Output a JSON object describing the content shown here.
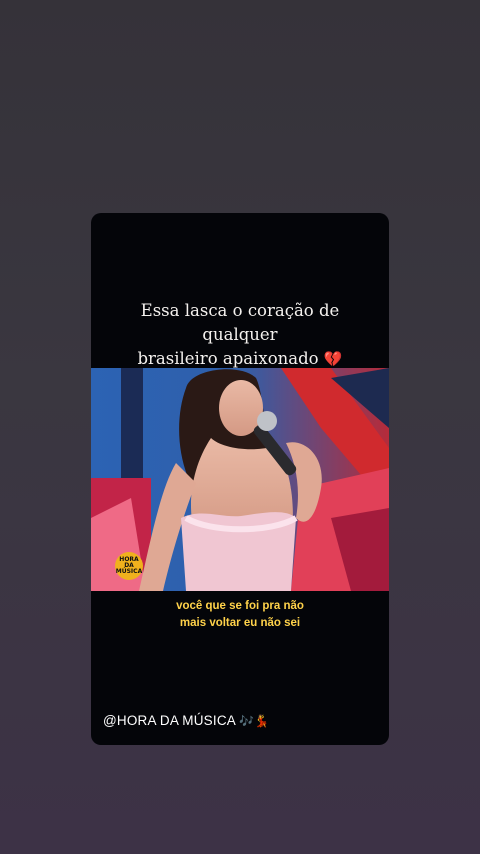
{
  "story": {
    "caption_line1": "Essa lasca o coração de qualquer",
    "caption_line2": "brasileiro apaixonado",
    "caption_emoji": "💔",
    "subtitle_line1": "você que se foi pra não",
    "subtitle_line2": "mais voltar eu não sei",
    "credit_text": "@HORA DA MÚSICA",
    "credit_emojis": "🎶💃",
    "video_logo_text": "HORA DA MÚSICA"
  },
  "colors": {
    "caption": "#f4f1ee",
    "subtitle": "#ffd24a",
    "card_bg": "#040509",
    "logo": "#f0b11d"
  }
}
